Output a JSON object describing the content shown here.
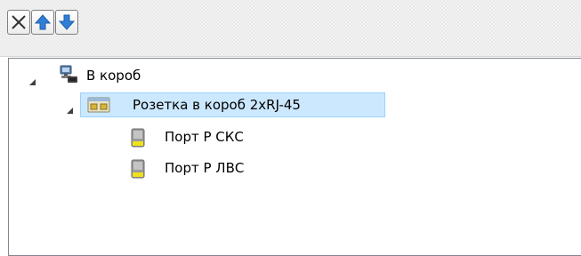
{
  "toolbar": {
    "buttons": [
      {
        "icon": "close-icon"
      },
      {
        "icon": "arrow-up-icon"
      },
      {
        "icon": "arrow-down-icon"
      }
    ]
  },
  "tree": {
    "root": {
      "label": "В короб",
      "icon": "computer-network-icon",
      "expanded": true,
      "children": [
        {
          "label": "Розетка в короб 2xRJ-45",
          "icon": "socket-icon",
          "expanded": true,
          "selected": true,
          "children": [
            {
              "label": "Порт Р СКС",
              "icon": "port-icon"
            },
            {
              "label": "Порт Р ЛВС",
              "icon": "port-icon"
            }
          ]
        }
      ]
    }
  },
  "colors": {
    "selection_bg": "#cce8ff",
    "selection_border": "#99d1ff",
    "arrow_blue": "#2f7fd8"
  }
}
